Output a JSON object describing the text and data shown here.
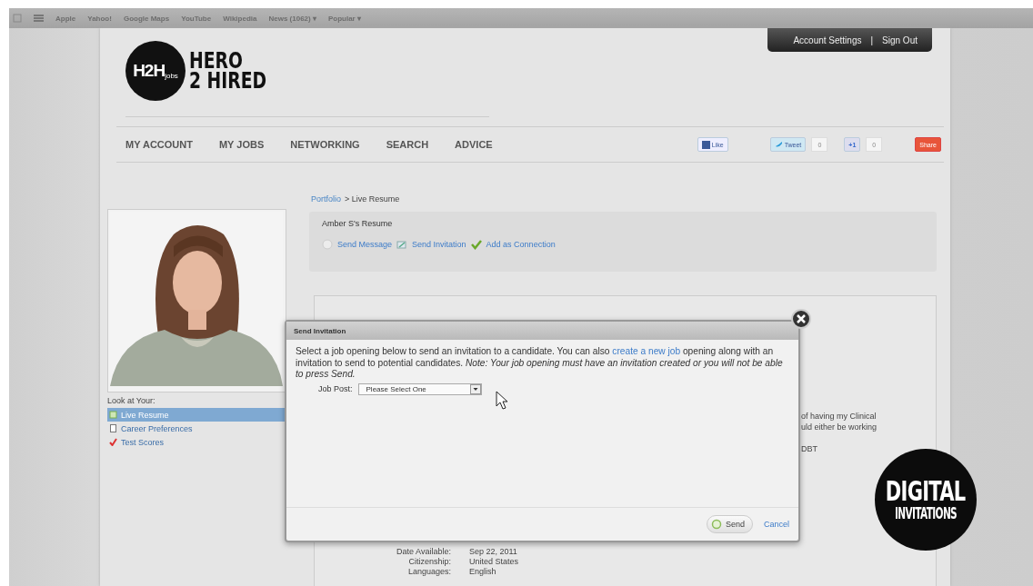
{
  "bookmarks": [
    "Apple",
    "Yahoo!",
    "Google Maps",
    "YouTube",
    "Wikipedia",
    "News (1062) ▾",
    "Popular ▾"
  ],
  "account_links": {
    "settings": "Account Settings",
    "separator": "|",
    "sign_out": "Sign Out"
  },
  "logo": {
    "badge": "H2H",
    "badge_sub": "jobs",
    "line1": "HERO",
    "line2": "2 HIRED"
  },
  "nav": [
    "MY ACCOUNT",
    "MY JOBS",
    "NETWORKING",
    "SEARCH",
    "ADVICE"
  ],
  "social": [
    {
      "kind": "like",
      "label": "Like"
    },
    {
      "kind": "tweet",
      "label": "Tweet",
      "count": "0"
    },
    {
      "kind": "plusone",
      "label": "+1",
      "count": "0"
    },
    {
      "kind": "share",
      "label": "Share"
    }
  ],
  "sidebar": {
    "heading": "Look at Your:",
    "items": [
      {
        "kind": "resume",
        "label": "Live Resume",
        "selected": true
      },
      {
        "kind": "preferences",
        "label": "Career Preferences",
        "selected": false
      },
      {
        "kind": "scores",
        "label": "Test Scores",
        "selected": false
      }
    ]
  },
  "breadcrumb": {
    "link": "Portfolio",
    "current": "> Live Resume"
  },
  "resume": {
    "title": "Amber S's Resume",
    "actions": [
      {
        "kind": "message",
        "label": "Send Message"
      },
      {
        "kind": "invitation",
        "label": "Send Invitation"
      },
      {
        "kind": "connection",
        "label": "Add as Connection"
      }
    ]
  },
  "background_text": [
    "of having my Clinical",
    "uld either be working",
    "DBT"
  ],
  "details": [
    {
      "label": "Date Available:",
      "value": "Sep 22, 2011"
    },
    {
      "label": "Citizenship:",
      "value": "United States"
    },
    {
      "label": "Languages:",
      "value": "English"
    }
  ],
  "dialog": {
    "title": "Send Invitation",
    "text_before": "Select a job opening below to send an invitation to a candidate. You can also ",
    "link": "create a new job",
    "text_after": " opening along with an invitation to send to potential candidates. *Note: Your job opening must have an invitation created or you will not be able to press Send.*",
    "field_label": "Job Post:",
    "select_value": "Please Select One",
    "send": "Send",
    "cancel": "Cancel"
  },
  "corner_badge": {
    "line1": "DIGITAL",
    "line2": "INVITATIONS"
  }
}
